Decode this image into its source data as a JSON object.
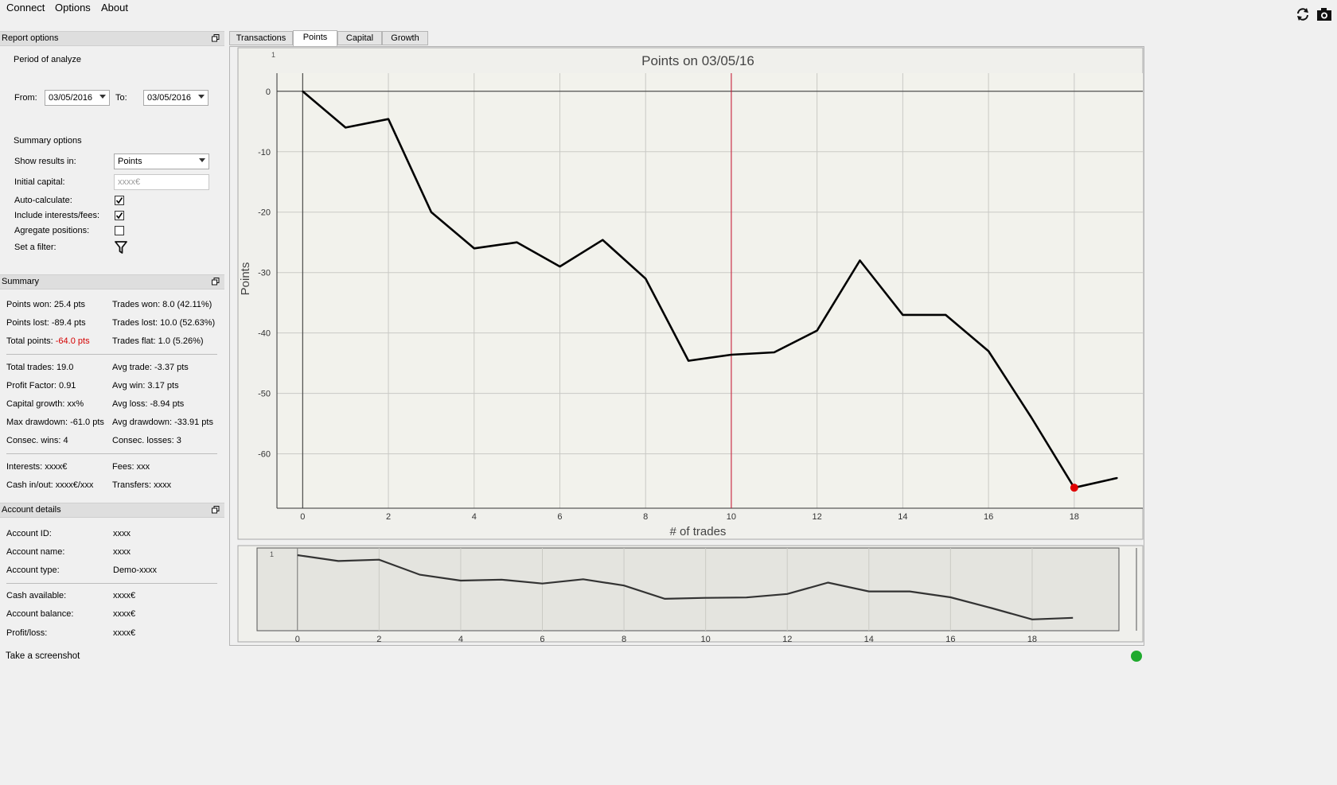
{
  "menu": {
    "connect": "Connect",
    "options": "Options",
    "about": "About"
  },
  "toolbar": {
    "refresh_icon": "refresh-icon",
    "camera_icon": "camera-icon"
  },
  "report_options": {
    "title": "Report options",
    "period_label": "Period of analyze",
    "from_label": "From:",
    "from_value": "03/05/2016",
    "to_label": "To:",
    "to_value": "03/05/2016",
    "summary_options_label": "Summary options",
    "show_results_label": "Show results in:",
    "show_results_value": "Points",
    "initial_capital_label": "Initial capital:",
    "initial_capital_placeholder": "xxxx€",
    "auto_calc_label": "Auto-calculate:",
    "auto_calc_checked": true,
    "include_fees_label": "Include interests/fees:",
    "include_fees_checked": true,
    "aggregate_label": "Agregate positions:",
    "aggregate_checked": false,
    "filter_label": "Set a filter:"
  },
  "summary": {
    "title": "Summary",
    "points_won": "Points won: 25.4 pts",
    "trades_won": "Trades won: 8.0 (42.11%)",
    "points_lost": "Points lost: -89.4 pts",
    "trades_lost": "Trades lost: 10.0 (52.63%)",
    "total_points_label": "Total points: ",
    "total_points_value": "-64.0 pts",
    "trades_flat": "Trades flat: 1.0 (5.26%)",
    "total_trades": "Total trades: 19.0",
    "avg_trade": "Avg trade: -3.37 pts",
    "profit_factor": "Profit Factor: 0.91",
    "avg_win": "Avg win: 3.17 pts",
    "capital_growth": "Capital growth: xx%",
    "avg_loss": "Avg loss: -8.94 pts",
    "max_drawdown": "Max drawdown: -61.0 pts",
    "avg_drawdown": "Avg drawdown: -33.91 pts",
    "consec_wins": "Consec. wins: 4",
    "consec_losses": "Consec. losses: 3",
    "interests": "Interests: xxxx€",
    "fees": "Fees: xxx",
    "cash_inout": "Cash in/out: xxxx€/xxx",
    "transfers": "Transfers: xxxx",
    "negative_color": "#d40000"
  },
  "account": {
    "title": "Account details",
    "rows": [
      {
        "label": "Account ID:",
        "value": "xxxx"
      },
      {
        "label": "Account name:",
        "value": "xxxx"
      },
      {
        "label": "Account type:",
        "value": "Demo-xxxx"
      },
      {
        "label": "Cash available:",
        "value": "xxxx€"
      },
      {
        "label": "Account balance:",
        "value": "xxxx€"
      },
      {
        "label": "Profit/loss:",
        "value": "xxxx€"
      }
    ]
  },
  "screenshot_label": "Take a screenshot",
  "status_color": "#1faa2e",
  "tabs": [
    "Transactions",
    "Points",
    "Capital",
    "Growth"
  ],
  "active_tab": "Points",
  "chart_data": {
    "type": "line",
    "title": "Points on 03/05/16",
    "xlabel": "# of trades",
    "ylabel": "Points",
    "x": [
      0,
      1,
      2,
      3,
      4,
      5,
      6,
      7,
      8,
      9,
      10,
      11,
      12,
      13,
      14,
      15,
      16,
      17,
      18,
      19
    ],
    "values": [
      0,
      -6,
      -4.6,
      -20,
      -26,
      -25,
      -29,
      -24.6,
      -31,
      -44.6,
      -43.6,
      -43.2,
      -39.6,
      -28,
      -37,
      -37,
      -43,
      -54,
      -65.6,
      -64
    ],
    "xlim": [
      -0.6,
      19.6
    ],
    "ylim": [
      -69,
      3
    ],
    "xticks": [
      0,
      2,
      4,
      6,
      8,
      10,
      12,
      14,
      16,
      18
    ],
    "yticks": [
      0,
      -10,
      -20,
      -30,
      -40,
      -50,
      -60
    ],
    "vline_x": 10,
    "vline_color": "#c8102e",
    "highlight_x": 18,
    "highlight_color": "#e00000",
    "grid": true,
    "corner_label": "1",
    "overview_corner_label": "1"
  }
}
